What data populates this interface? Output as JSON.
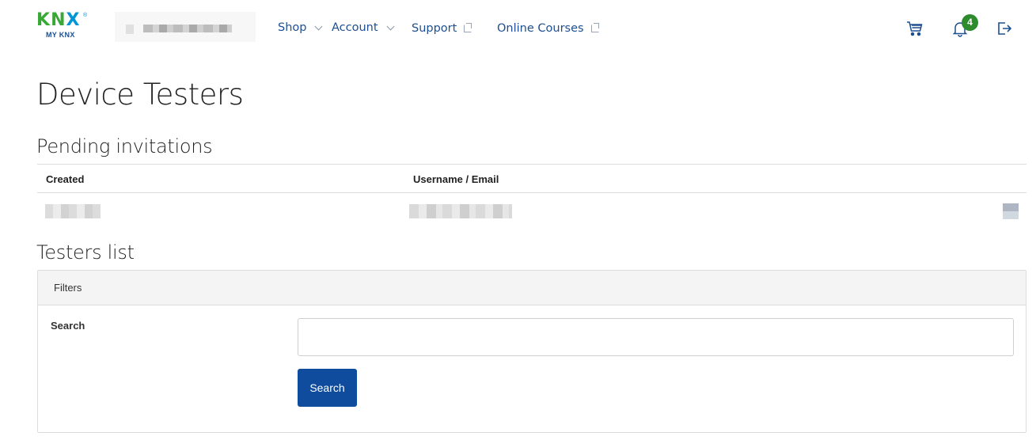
{
  "header": {
    "logo_text": "KNX",
    "logo_sub": "MY KNX",
    "nav": [
      {
        "label": "Shop",
        "type": "dropdown"
      },
      {
        "label": "Account",
        "type": "dropdown"
      },
      {
        "label": "Support",
        "type": "external"
      },
      {
        "label": "Online Courses",
        "type": "external"
      }
    ],
    "icons": [
      "cart-icon",
      "bell-icon",
      "logout-icon"
    ],
    "notification_count": "4"
  },
  "page": {
    "title": "Device Testers"
  },
  "pending": {
    "heading": "Pending invitations",
    "columns": [
      "Created",
      "Username / Email"
    ]
  },
  "testers": {
    "heading": "Testers list",
    "filters_label": "Filters",
    "search_label": "Search",
    "search_value": "",
    "search_placeholder": "",
    "search_button": "Search"
  },
  "colors": {
    "primary": "#0f4c9e",
    "link": "#1d4f91",
    "badge": "#2e8b2e"
  }
}
